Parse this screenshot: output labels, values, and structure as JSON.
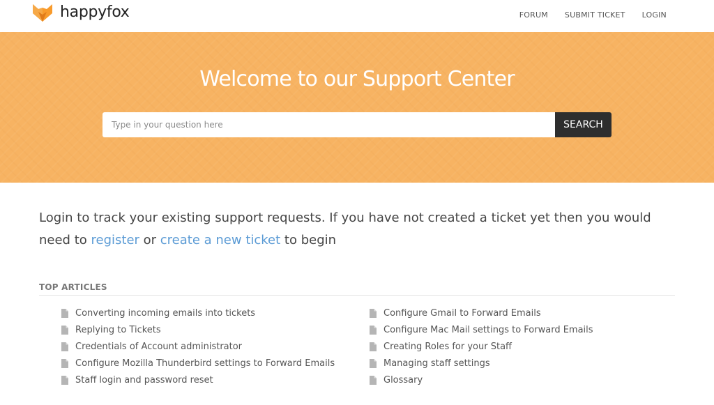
{
  "brand": {
    "name": "happyfox",
    "icon": "fox-logo-icon",
    "colors": {
      "fox_orange": "#f89b2c",
      "fox_dark": "#e07b1a",
      "hero_background": "#f7b362",
      "link": "#5b9bd5",
      "search_button": "#2e2e2e"
    }
  },
  "nav": {
    "items": [
      {
        "label": "FORUM"
      },
      {
        "label": "SUBMIT TICKET"
      },
      {
        "label": "LOGIN"
      }
    ]
  },
  "hero": {
    "title": "Welcome to our Support Center",
    "search": {
      "placeholder": "Type in your question here",
      "value": "",
      "button_label": "SEARCH"
    }
  },
  "intro": {
    "text_before": "Login to track your existing support requests. If you have not created a ticket yet then you would need to ",
    "register_link": "register",
    "text_middle": " or ",
    "create_link": "create a new ticket",
    "text_after": " to begin"
  },
  "top_articles": {
    "heading": "TOP ARTICLES",
    "item_icon": "document-icon",
    "left_column": [
      {
        "title": "Converting incoming emails into tickets"
      },
      {
        "title": "Replying to Tickets"
      },
      {
        "title": "Credentials of Account administrator"
      },
      {
        "title": "Configure Mozilla Thunderbird settings to Forward Emails"
      },
      {
        "title": "Staff login and password reset"
      }
    ],
    "right_column": [
      {
        "title": "Configure Gmail to Forward Emails"
      },
      {
        "title": "Configure Mac Mail settings to Forward Emails"
      },
      {
        "title": "Creating Roles for your Staff"
      },
      {
        "title": "Managing staff settings"
      },
      {
        "title": "Glossary"
      }
    ]
  }
}
